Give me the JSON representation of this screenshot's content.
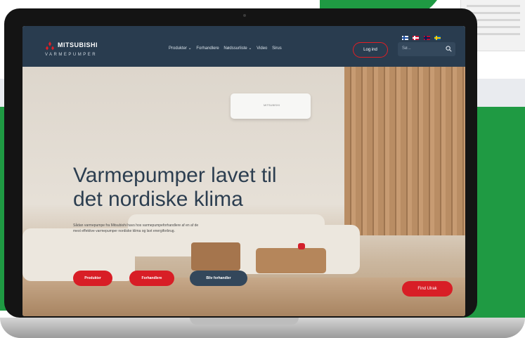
{
  "site": {
    "brand_name": "MITSUBISHI",
    "brand_sub": "VARMEPUMPER",
    "nav_items": [
      "Produkter ⌄",
      "Forhandlere",
      "Nødssurliste ⌄",
      "Video",
      "Sirus"
    ],
    "login_label": "Log ind",
    "search_placeholder": "Sø...",
    "flags": [
      "Finland",
      "Denmark",
      "Norway",
      "Sweden"
    ]
  },
  "hero": {
    "headline_line1": "Varmepumper lavet til",
    "headline_line2": "det nordiske klima",
    "subtext": "Sådan varmepumpe fra Mitsubishi havs hos varmepumpeforhandlere af en af de mest effektive varmepumper nordiske klima og lavt energiforbrug.",
    "buttons": [
      "Produkter",
      "Forhandlere",
      "Bliv forhandler"
    ],
    "cta_label": "Find Ulrak",
    "ac_label": "MITSUBISHI"
  },
  "colors": {
    "nav_bg": "#293c4f",
    "accent_red": "#d81e26",
    "brand_green": "#1f9a43",
    "dark_button": "#33475b"
  }
}
